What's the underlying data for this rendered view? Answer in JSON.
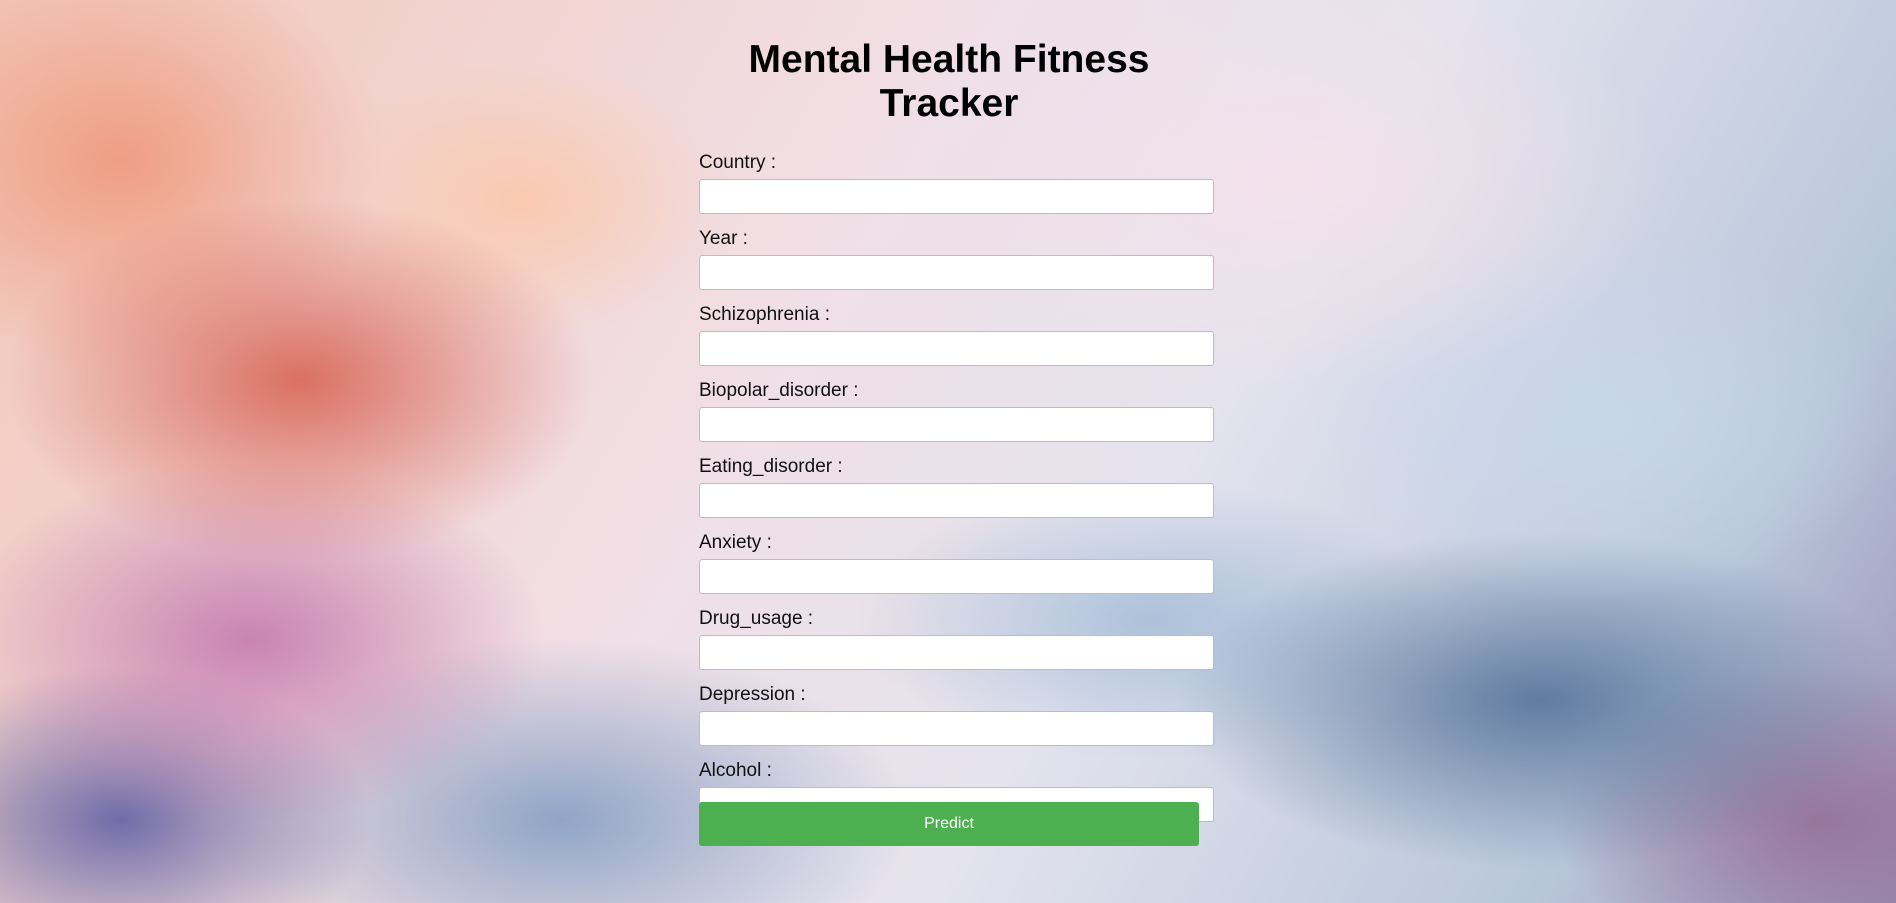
{
  "page": {
    "title": "Mental Health Fitness Tracker"
  },
  "form": {
    "fields": [
      {
        "label": "Country :",
        "value": ""
      },
      {
        "label": "Year :",
        "value": ""
      },
      {
        "label": "Schizophrenia :",
        "value": ""
      },
      {
        "label": "Biopolar_disorder :",
        "value": ""
      },
      {
        "label": "Eating_disorder :",
        "value": ""
      },
      {
        "label": "Anxiety :",
        "value": ""
      },
      {
        "label": "Drug_usage :",
        "value": ""
      },
      {
        "label": "Depression :",
        "value": ""
      },
      {
        "label": "Alcohol :",
        "value": ""
      }
    ],
    "submit_label": "Predict",
    "submit_color": "#4caf50"
  }
}
